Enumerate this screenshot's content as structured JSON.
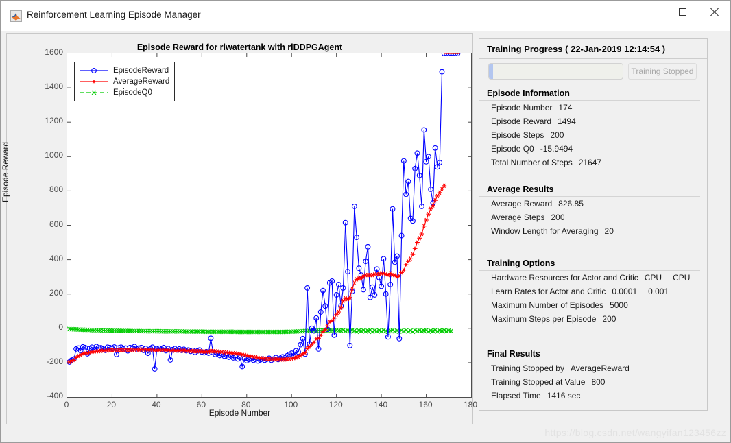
{
  "window": {
    "title": "Reinforcement Learning Episode Manager",
    "icon": "matlab-icon",
    "controls": {
      "minimize": "minimize",
      "maximize": "maximize",
      "close": "close"
    }
  },
  "plot": {
    "title": "Episode Reward for rlwatertank with rlDDPGAgent",
    "legend": [
      {
        "label": "EpisodeReward",
        "color": "#0000ff",
        "marker": "circle",
        "style": "solid"
      },
      {
        "label": "AverageReward",
        "color": "#ff0000",
        "marker": "asterisk",
        "style": "solid"
      },
      {
        "label": "EpisodeQ0",
        "color": "#00cc00",
        "marker": "x",
        "style": "dashed"
      }
    ]
  },
  "panel": {
    "header": "Training Progress ( 22-Jan-2019 12:14:54 )",
    "progress_percent": 3,
    "stop_button": "Training Stopped",
    "sections": [
      {
        "title": "Episode Information",
        "rows": [
          {
            "key": "Episode Number",
            "value": "174"
          },
          {
            "key": "Episode Reward",
            "value": "1494"
          },
          {
            "key": "Episode Steps",
            "value": "200"
          },
          {
            "key": "Episode Q0",
            "value": "-15.9494"
          },
          {
            "key": "Total Number of Steps",
            "value": "21647"
          }
        ]
      },
      {
        "title": "Average Results",
        "rows": [
          {
            "key": "Average Reward",
            "value": "826.85"
          },
          {
            "key": "Average Steps",
            "value": "200"
          },
          {
            "key": "Window Length for Averaging",
            "value": "20"
          }
        ]
      },
      {
        "title": "Training Options",
        "rows": [
          {
            "key": "Hardware Resources for Actor and Critic",
            "value": "CPU",
            "value2": "CPU"
          },
          {
            "key": "Learn Rates for Actor and Critic",
            "value": "0.0001",
            "value2": "0.001"
          },
          {
            "key": "Maximum Number of Episodes",
            "value": "5000"
          },
          {
            "key": "Maximum Steps per Episode",
            "value": "200"
          }
        ]
      },
      {
        "title": "Final Results",
        "rows": [
          {
            "key": "Training Stopped by",
            "value": "AverageReward"
          },
          {
            "key": "Training Stopped at Value",
            "value": "800"
          },
          {
            "key": "Elapsed Time",
            "value": "1416 sec"
          }
        ]
      }
    ]
  },
  "watermark": "https://blog.csdn.net/wangyifan123456zz",
  "chart_data": {
    "type": "line",
    "title": "Episode Reward for rlwatertank with rlDDPGAgent",
    "xlabel": "Episode Number",
    "ylabel": "Episode Reward",
    "xlim": [
      0,
      180
    ],
    "ylim": [
      -400,
      1600
    ],
    "xticks": [
      0,
      20,
      40,
      60,
      80,
      100,
      120,
      140,
      160,
      180
    ],
    "yticks": [
      -400,
      -200,
      0,
      200,
      400,
      600,
      800,
      1000,
      1200,
      1400,
      1600
    ],
    "grid": false,
    "legend_position": "top-left",
    "series": [
      {
        "name": "EpisodeReward",
        "color": "#0000ff",
        "marker": "circle",
        "style": "solid",
        "x": [
          1,
          2,
          3,
          4,
          5,
          6,
          7,
          8,
          9,
          10,
          11,
          12,
          13,
          14,
          15,
          16,
          17,
          18,
          19,
          20,
          21,
          22,
          23,
          24,
          25,
          26,
          27,
          28,
          29,
          30,
          31,
          32,
          33,
          34,
          35,
          36,
          37,
          38,
          39,
          40,
          41,
          42,
          43,
          44,
          45,
          46,
          47,
          48,
          49,
          50,
          51,
          52,
          53,
          54,
          55,
          56,
          57,
          58,
          59,
          60,
          61,
          62,
          63,
          64,
          65,
          66,
          67,
          68,
          69,
          70,
          71,
          72,
          73,
          74,
          75,
          76,
          77,
          78,
          79,
          80,
          81,
          82,
          83,
          84,
          85,
          86,
          87,
          88,
          89,
          90,
          91,
          92,
          93,
          94,
          95,
          96,
          97,
          98,
          99,
          100,
          101,
          102,
          103,
          104,
          105,
          106,
          107,
          108,
          109,
          110,
          111,
          112,
          113,
          114,
          115,
          116,
          117,
          118,
          119,
          120,
          121,
          122,
          123,
          124,
          125,
          126,
          127,
          128,
          129,
          130,
          131,
          132,
          133,
          134,
          135,
          136,
          137,
          138,
          139,
          140,
          141,
          142,
          143,
          144,
          145,
          146,
          147,
          148,
          149,
          150,
          151,
          152,
          153,
          154,
          155,
          156,
          157,
          158,
          159,
          160,
          161,
          162,
          163,
          164,
          165,
          166,
          167,
          168,
          169,
          170,
          171,
          172,
          173,
          174
        ],
        "y": [
          -196,
          -185,
          -178,
          -120,
          -115,
          -130,
          -108,
          -112,
          -148,
          -118,
          -110,
          -125,
          -106,
          -115,
          -113,
          -120,
          -128,
          -110,
          -112,
          -118,
          -109,
          -152,
          -114,
          -110,
          -120,
          -115,
          -131,
          -112,
          -118,
          -106,
          -120,
          -115,
          -112,
          -128,
          -117,
          -145,
          -120,
          -110,
          -236,
          -118,
          -116,
          -122,
          -112,
          -130,
          -118,
          -184,
          -124,
          -118,
          -126,
          -120,
          -128,
          -122,
          -130,
          -126,
          -134,
          -128,
          -140,
          -132,
          -126,
          -138,
          -142,
          -136,
          -144,
          -58,
          -140,
          -152,
          -146,
          -158,
          -150,
          -162,
          -156,
          -168,
          -160,
          -172,
          -166,
          -178,
          -170,
          -222,
          -176,
          -188,
          -182,
          -175,
          -186,
          -180,
          -190,
          -184,
          -178,
          -186,
          -180,
          -174,
          -186,
          -178,
          -170,
          -182,
          -174,
          -166,
          -172,
          -160,
          -152,
          -145,
          -160,
          -130,
          -138,
          -95,
          -60,
          -150,
          235,
          -90,
          0,
          -15,
          60,
          -120,
          95,
          220,
          130,
          -5,
          265,
          275,
          -40,
          195,
          255,
          130,
          235,
          615,
          330,
          -100,
          215,
          710,
          530,
          350,
          310,
          225,
          390,
          475,
          180,
          240,
          195,
          345,
          295,
          245,
          405,
          200,
          -50,
          255,
          695,
          385,
          420,
          -60,
          540,
          975,
          780,
          855,
          640,
          625,
          930,
          1020,
          890,
          710,
          1155,
          970,
          1000,
          810,
          730,
          1050,
          940,
          965,
          1494
        ],
        "y_description": "Per-episode reward; starts near -200/-110 with noisy plateau, rises sharply after episode ~105, final spike 1494 at episode 174"
      },
      {
        "name": "AverageReward",
        "color": "#ff0000",
        "marker": "asterisk",
        "style": "solid",
        "x": [
          1,
          2,
          3,
          4,
          5,
          6,
          7,
          8,
          9,
          10,
          11,
          12,
          13,
          14,
          15,
          16,
          17,
          18,
          19,
          20,
          21,
          22,
          23,
          24,
          25,
          26,
          27,
          28,
          29,
          30,
          31,
          32,
          33,
          34,
          35,
          36,
          37,
          38,
          39,
          40,
          41,
          42,
          43,
          44,
          45,
          46,
          47,
          48,
          49,
          50,
          51,
          52,
          53,
          54,
          55,
          56,
          57,
          58,
          59,
          60,
          61,
          62,
          63,
          64,
          65,
          66,
          67,
          68,
          69,
          70,
          71,
          72,
          73,
          74,
          75,
          76,
          77,
          78,
          79,
          80,
          81,
          82,
          83,
          84,
          85,
          86,
          87,
          88,
          89,
          90,
          91,
          92,
          93,
          94,
          95,
          96,
          97,
          98,
          99,
          100,
          101,
          102,
          103,
          104,
          105,
          106,
          107,
          108,
          109,
          110,
          111,
          112,
          113,
          114,
          115,
          116,
          117,
          118,
          119,
          120,
          121,
          122,
          123,
          124,
          125,
          126,
          127,
          128,
          129,
          130,
          131,
          132,
          133,
          134,
          135,
          136,
          137,
          138,
          139,
          140,
          141,
          142,
          143,
          144,
          145,
          146,
          147,
          148,
          149,
          150,
          151,
          152,
          153,
          154,
          155,
          156,
          157,
          158,
          159,
          160,
          161,
          162,
          163,
          164,
          165,
          166,
          167,
          168,
          169,
          170,
          171,
          172,
          173,
          174
        ],
        "y": [
          -196,
          -190,
          -186,
          -170,
          -160,
          -155,
          -148,
          -144,
          -144,
          -141,
          -138,
          -137,
          -134,
          -133,
          -131,
          -130,
          -130,
          -129,
          -128,
          -127,
          -126,
          -128,
          -127,
          -126,
          -126,
          -125,
          -126,
          -125,
          -125,
          -124,
          -124,
          -124,
          -123,
          -124,
          -124,
          -125,
          -125,
          -125,
          -128,
          -128,
          -127,
          -127,
          -126,
          -127,
          -127,
          -130,
          -130,
          -130,
          -130,
          -130,
          -130,
          -130,
          -131,
          -131,
          -132,
          -132,
          -133,
          -133,
          -133,
          -134,
          -135,
          -135,
          -136,
          -132,
          -133,
          -134,
          -135,
          -137,
          -138,
          -139,
          -140,
          -142,
          -143,
          -145,
          -146,
          -148,
          -149,
          -153,
          -155,
          -158,
          -161,
          -163,
          -166,
          -168,
          -171,
          -173,
          -174,
          -176,
          -178,
          -179,
          -180,
          -181,
          -181,
          -182,
          -182,
          -182,
          -182,
          -180,
          -178,
          -176,
          -174,
          -170,
          -166,
          -158,
          -148,
          -142,
          -118,
          -106,
          -92,
          -80,
          -62,
          -58,
          -40,
          -20,
          -8,
          14,
          38,
          44,
          60,
          80,
          95,
          120,
          160,
          175,
          170,
          180,
          230,
          265,
          285,
          290,
          290,
          300,
          310,
          310,
          310,
          310,
          315,
          315,
          315,
          320,
          320,
          315,
          310,
          320,
          310,
          310,
          300,
          305,
          325,
          340,
          370,
          390,
          405,
          430,
          465,
          500,
          525,
          550,
          595,
          630,
          665,
          695,
          715,
          745,
          770,
          790,
          810,
          830
        ],
        "y_description": "Moving average over window of 20 episodes; ends at 826.85 crossing stop value 800"
      },
      {
        "name": "EpisodeQ0",
        "color": "#00cc00",
        "marker": "x",
        "style": "dashed",
        "x": [
          1,
          2,
          3,
          4,
          5,
          6,
          7,
          8,
          9,
          10,
          11,
          12,
          13,
          14,
          15,
          16,
          17,
          18,
          19,
          20,
          21,
          22,
          23,
          24,
          25,
          26,
          27,
          28,
          29,
          30,
          31,
          32,
          33,
          34,
          35,
          36,
          37,
          38,
          39,
          40,
          41,
          42,
          43,
          44,
          45,
          46,
          47,
          48,
          49,
          50,
          51,
          52,
          53,
          54,
          55,
          56,
          57,
          58,
          59,
          60,
          61,
          62,
          63,
          64,
          65,
          66,
          67,
          68,
          69,
          70,
          71,
          72,
          73,
          74,
          75,
          76,
          77,
          78,
          79,
          80,
          81,
          82,
          83,
          84,
          85,
          86,
          87,
          88,
          89,
          90,
          91,
          92,
          93,
          94,
          95,
          96,
          97,
          98,
          99,
          100,
          101,
          102,
          103,
          104,
          105,
          106,
          107,
          108,
          109,
          110,
          111,
          112,
          113,
          114,
          115,
          116,
          117,
          118,
          119,
          120,
          121,
          122,
          123,
          124,
          125,
          126,
          127,
          128,
          129,
          130,
          131,
          132,
          133,
          134,
          135,
          136,
          137,
          138,
          139,
          140,
          141,
          142,
          143,
          144,
          145,
          146,
          147,
          148,
          149,
          150,
          151,
          152,
          153,
          154,
          155,
          156,
          157,
          158,
          159,
          160,
          161,
          162,
          163,
          164,
          165,
          166,
          167,
          168,
          169,
          170,
          171,
          172,
          173,
          174
        ],
        "y": [
          -4,
          -5,
          -6,
          -6,
          -7,
          -8,
          -8,
          -9,
          -9,
          -10,
          -10,
          -11,
          -11,
          -12,
          -12,
          -12,
          -13,
          -13,
          -13,
          -14,
          -14,
          -14,
          -14,
          -15,
          -15,
          -15,
          -15,
          -15,
          -16,
          -16,
          -16,
          -16,
          -16,
          -16,
          -17,
          -17,
          -17,
          -17,
          -17,
          -17,
          -17,
          -18,
          -18,
          -18,
          -18,
          -18,
          -18,
          -18,
          -18,
          -18,
          -18,
          -19,
          -19,
          -19,
          -19,
          -19,
          -19,
          -19,
          -19,
          -19,
          -19,
          -20,
          -20,
          -20,
          -20,
          -20,
          -20,
          -20,
          -20,
          -20,
          -20,
          -20,
          -20,
          -20,
          -20,
          -21,
          -21,
          -21,
          -21,
          -21,
          -21,
          -21,
          -21,
          -21,
          -21,
          -21,
          -21,
          -21,
          -21,
          -21,
          -21,
          -21,
          -21,
          -21,
          -21,
          -21,
          -20,
          -20,
          -20,
          -20,
          -19,
          -19,
          -18,
          -18,
          -17,
          -16,
          -16,
          -15,
          -15,
          -14,
          -14,
          -13,
          -13,
          -12,
          -12,
          -12,
          -11,
          -11,
          -11,
          -10,
          -12,
          -14,
          -10,
          -16,
          -12,
          -18,
          -10,
          -14,
          -20,
          -12,
          -16,
          -11,
          -18,
          -14,
          -10,
          -20,
          -13,
          -16,
          -12,
          -18,
          -11,
          -15,
          -20,
          -13,
          -10,
          -17,
          -14,
          -19,
          -12,
          -16,
          -11,
          -18,
          -13,
          -20,
          -10,
          -15,
          -12,
          -17,
          -14,
          -11,
          -19,
          -13,
          -16,
          -10,
          -18,
          -12,
          -15,
          -11,
          -17,
          -13,
          -16
        ],
        "y_description": "Critic estimate of episode-start value; flat band just below zero, around -4 to -21"
      }
    ]
  }
}
